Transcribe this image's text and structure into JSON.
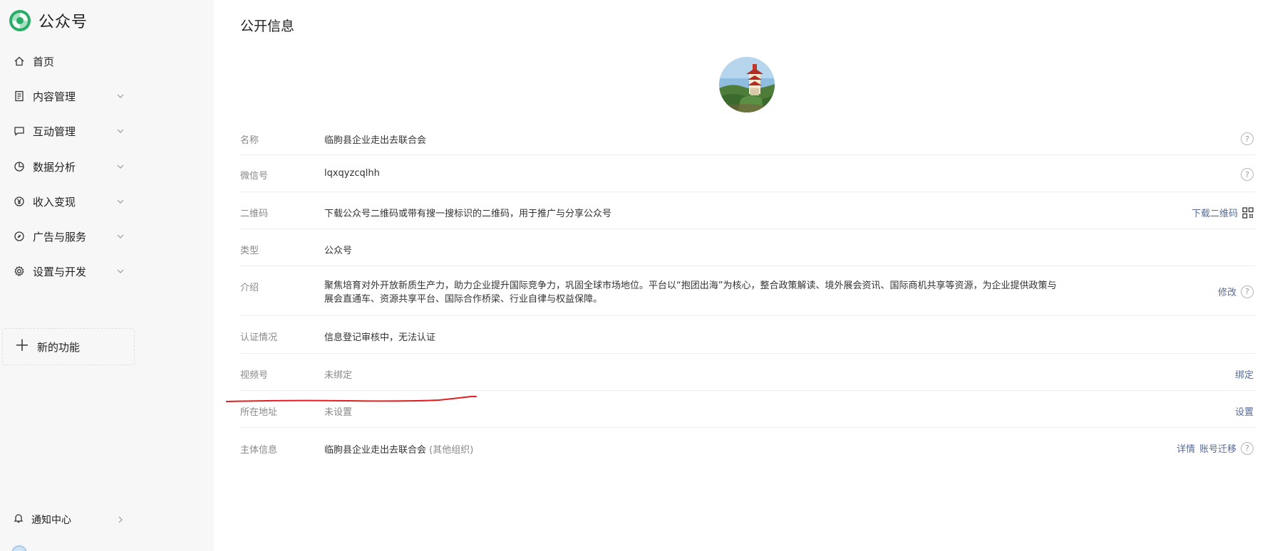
{
  "app": {
    "brand": "公众号",
    "brand_color": "#2aae67"
  },
  "sidebar": {
    "items": [
      {
        "label": "首页",
        "icon": "home-icon",
        "has_chevron": false
      },
      {
        "label": "内容管理",
        "icon": "document-icon",
        "has_chevron": true
      },
      {
        "label": "互动管理",
        "icon": "chat-icon",
        "has_chevron": true
      },
      {
        "label": "数据分析",
        "icon": "pie-chart-icon",
        "has_chevron": true
      },
      {
        "label": "收入变现",
        "icon": "yen-icon",
        "has_chevron": true
      },
      {
        "label": "广告与服务",
        "icon": "compass-icon",
        "has_chevron": true
      },
      {
        "label": "设置与开发",
        "icon": "gear-icon",
        "has_chevron": true
      }
    ],
    "new_feature": "新的功能",
    "notification": "通知中心"
  },
  "main": {
    "title": "公开信息",
    "rows": {
      "name": {
        "label": "名称",
        "value": "临朐县企业走出去联合会"
      },
      "wechat_id": {
        "label": "微信号",
        "value": "lqxqyzcqlhh"
      },
      "qrcode": {
        "label": "二维码",
        "value": "下载公众号二维码或带有搜一搜标识的二维码，用于推广与分享公众号",
        "action": "下载二维码"
      },
      "type": {
        "label": "类型",
        "value": "公众号"
      },
      "intro": {
        "label": "介绍",
        "value": "聚焦培育对外开放新质生产力，助力企业提升国际竞争力，巩固全球市场地位。平台以“抱团出海”为核心，整合政策解读、境外展会资讯、国际商机共享等资源，为企业提供政策与展会直通车、资源共享平台、国际合作桥梁、行业自律与权益保障。",
        "action": "修改"
      },
      "verification": {
        "label": "认证情况",
        "value": "信息登记审核中，无法认证"
      },
      "channels": {
        "label": "视频号",
        "value": "未绑定",
        "action": "绑定"
      },
      "address": {
        "label": "所在地址",
        "value": "未设置",
        "action": "设置"
      },
      "entity": {
        "label": "主体信息",
        "value": "临朐县企业走出去联合会",
        "value_sub": "(其他组织)",
        "action_detail": "详情",
        "action_migrate": "账号迁移"
      }
    },
    "help_glyph": "?"
  },
  "colors": {
    "link": "#576b95",
    "annotation_red": "#e02020"
  }
}
